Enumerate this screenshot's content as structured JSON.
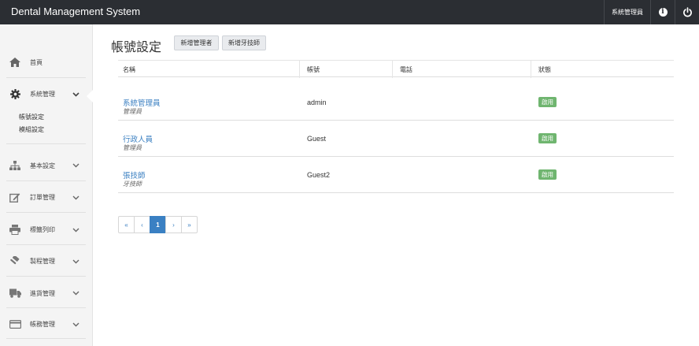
{
  "app": {
    "title": "Dental Management System"
  },
  "topbar": {
    "user_label": "系統管理員",
    "info_icon": "info-icon",
    "power_icon": "power-icon"
  },
  "sidebar": {
    "items": [
      {
        "label": "首頁",
        "icon": "home-icon"
      },
      {
        "label": "系統管理",
        "icon": "gear-icon",
        "expanded": true,
        "subitems": [
          {
            "label": "帳號設定"
          },
          {
            "label": "模組設定"
          }
        ]
      },
      {
        "label": "基本設定",
        "icon": "sitemap-icon"
      },
      {
        "label": "訂單管理",
        "icon": "edit-icon"
      },
      {
        "label": "標籤列印",
        "icon": "printer-icon"
      },
      {
        "label": "製程管理",
        "icon": "gavel-icon"
      },
      {
        "label": "進貨管理",
        "icon": "truck-icon"
      },
      {
        "label": "帳務管理",
        "icon": "credit-card-icon"
      }
    ]
  },
  "main": {
    "title": "帳號設定",
    "buttons": {
      "add_admin": "新增管理者",
      "add_technician": "新增牙技師"
    },
    "table": {
      "headers": [
        "名稱",
        "帳號",
        "電話",
        "狀態"
      ],
      "rows": [
        {
          "name": "系統管理員",
          "role": "管理員",
          "account": "admin",
          "phone": "",
          "status": "啟用"
        },
        {
          "name": "行政人員",
          "role": "管理員",
          "account": "Guest",
          "phone": "",
          "status": "啟用"
        },
        {
          "name": "張技師",
          "role": "牙技師",
          "account": "Guest2",
          "phone": "",
          "status": "啟用"
        }
      ]
    },
    "pagination": {
      "first": "«",
      "prev": "‹",
      "current": "1",
      "next": "›",
      "last": "»"
    }
  },
  "colors": {
    "topbar": "#2b2e33",
    "link": "#3a7fc1",
    "badge": "#6fb56f",
    "active_page": "#3a80c3"
  }
}
